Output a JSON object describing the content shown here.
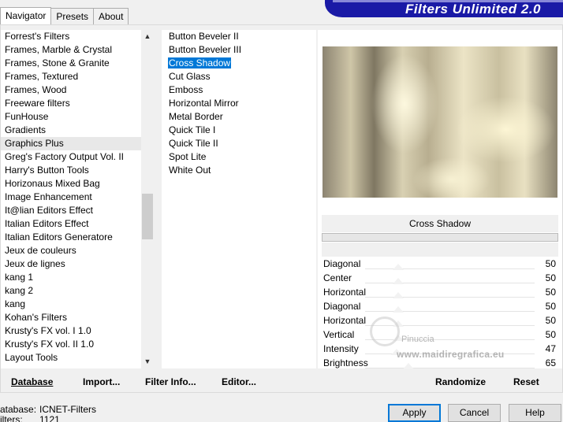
{
  "tabs": [
    "Navigator",
    "Presets",
    "About"
  ],
  "banner_title": "Filters Unlimited 2.0",
  "categories": [
    "Forrest's Filters",
    "Frames, Marble & Crystal",
    "Frames, Stone & Granite",
    "Frames, Textured",
    "Frames, Wood",
    "Freeware filters",
    "FunHouse",
    "Gradients",
    "Graphics Plus",
    "Greg's Factory Output Vol. II",
    "Harry's Button Tools",
    "Horizonaus Mixed Bag",
    "Image Enhancement",
    "It@lian Editors Effect",
    "Italian Editors Effect",
    "Italian Editors Generatore",
    "Jeux de couleurs",
    "Jeux de lignes",
    "kang 1",
    "kang 2",
    "kang",
    "Kohan's Filters",
    "Krusty's FX vol. I 1.0",
    "Krusty's FX vol. II 1.0",
    "Layout Tools"
  ],
  "selected_category": "Graphics Plus",
  "filters": [
    "Button Beveler II",
    "Button Beveler III",
    "Cross Shadow",
    "Cut Glass",
    "Emboss",
    "Horizontal Mirror",
    "Metal Border",
    "Quick Tile I",
    "Quick Tile II",
    "Spot Lite",
    "White Out"
  ],
  "selected_filter": "Cross Shadow",
  "filter_name": "Cross Shadow",
  "params": [
    {
      "label": "Diagonal",
      "value": "50"
    },
    {
      "label": "Center",
      "value": "50"
    },
    {
      "label": "Horizontal",
      "value": "50"
    },
    {
      "label": "Diagonal",
      "value": "50"
    },
    {
      "label": "Horizontal",
      "value": "50"
    },
    {
      "label": "Vertical",
      "value": "50"
    },
    {
      "label": "Intensity",
      "value": "47"
    },
    {
      "label": "Brightness",
      "value": "65"
    }
  ],
  "watermark": {
    "line1": "Pinuccia",
    "line2": "www.maidiregrafica.eu"
  },
  "toolbar": {
    "database": "Database",
    "import": "Import...",
    "filter_info": "Filter Info...",
    "editor": "Editor...",
    "randomize": "Randomize",
    "reset": "Reset"
  },
  "footer": {
    "database_label": "atabase:",
    "database_value": "ICNET-Filters",
    "filters_label": "ilters:",
    "filters_value": "1121"
  },
  "dialog": {
    "apply": "Apply",
    "cancel": "Cancel",
    "help": "Help"
  },
  "scroll_arrows": {
    "up": "▲",
    "down": "▼"
  }
}
